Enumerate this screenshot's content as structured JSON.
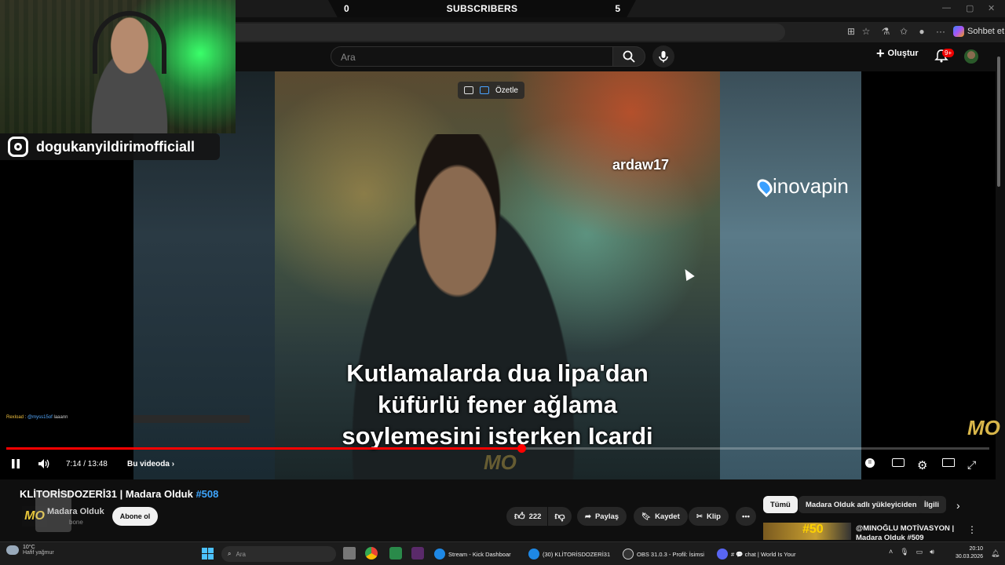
{
  "overlay": {
    "subs_left": "0",
    "subs_label": "SUBSCRIBERS",
    "subs_right": "5",
    "instagram_handle": "dogukanyildirimofficiall",
    "chat_user": "Rexload",
    "chat_sep": " : ",
    "chat_mention": "@myss15of",
    "chat_msg": " laaann"
  },
  "browser": {
    "chat_label": "Sohbet et",
    "more_icon": "ellipsis-icon"
  },
  "youtube": {
    "search_placeholder": "Ara",
    "create_label": "Oluştur",
    "notif_badge": "9+"
  },
  "video": {
    "watermark_user": "ardaw17",
    "sponsor": "inovapin",
    "summarize_label": "Özetle",
    "subtitle_lines": [
      "Kutlamalarda dua lipa'dan",
      "küfürlü fener ağlama",
      "soylemesini isterken Icardi"
    ],
    "channel_mark": "MO",
    "progress_fraction": 0.5252
  },
  "controls": {
    "time": "7:14 / 13:48",
    "chapter": "Bu videoda"
  },
  "meta": {
    "title_main": "KLİTORİSDOZERİ31 | Madara Olduk ",
    "title_num": "#508",
    "channel": "Madara Olduk",
    "channel_subs": "bone",
    "subscribe": "Abone ol",
    "likes": "222",
    "share": "Paylaş",
    "save": "Kaydet",
    "clip": "Klip"
  },
  "sidebar": {
    "chips": [
      "Tümü",
      "Madara Olduk adlı yükleyiciden",
      "İlgili"
    ],
    "reco_thumb_text": "#50",
    "reco_title": "@MINOĞLU MOTİVASYON | Madara Olduk #509"
  },
  "taskbar": {
    "temp": "10°C",
    "weather": "Hafif yağmur",
    "search": "Ara",
    "tasks": [
      "Stream - Kick Dashboar",
      "(30) KLİTORİSDOZERİ31",
      "OBS 31.0.3 - Profil: İsimsi",
      "# 💬 chat | World Is Your"
    ],
    "time": "20:10",
    "date": "30.03.2026"
  },
  "colors": {
    "accent_red": "#ff0000",
    "link_blue": "#3ea6ff",
    "yt_bg": "#0f0f0f"
  }
}
